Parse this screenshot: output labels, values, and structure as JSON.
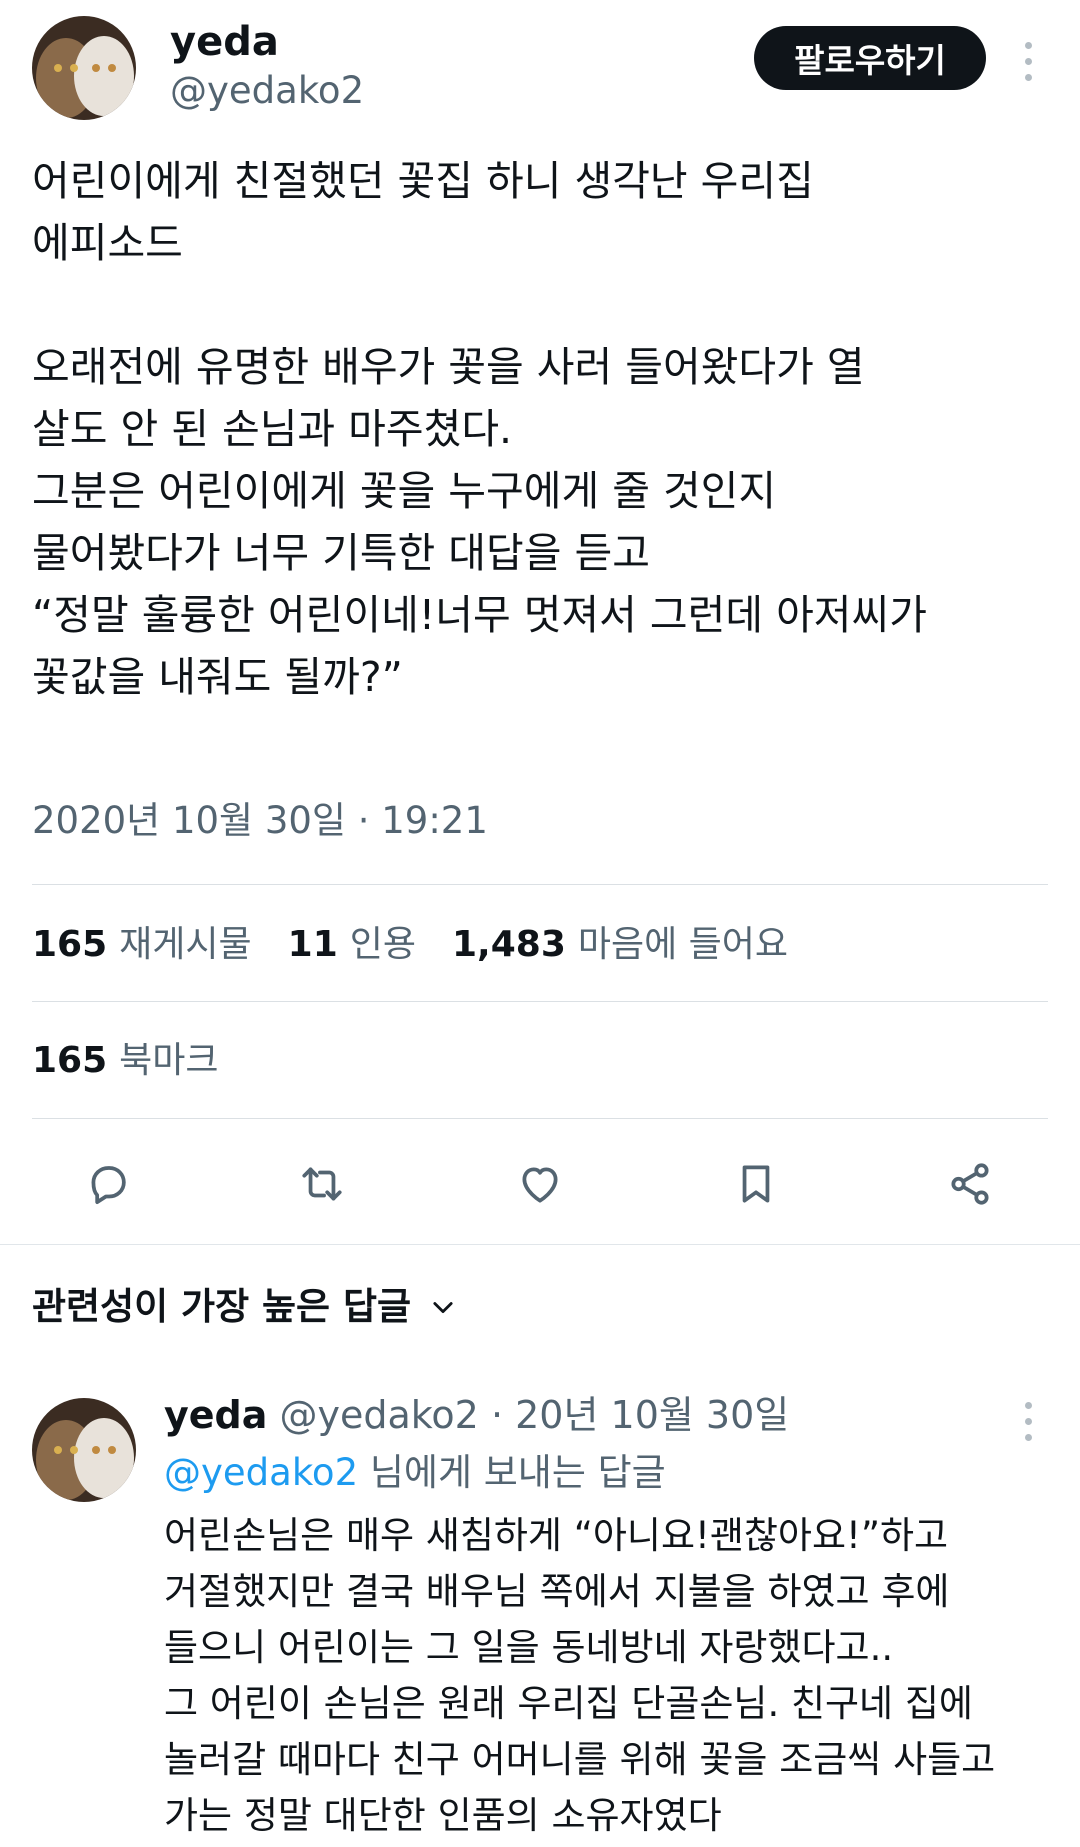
{
  "tweet": {
    "author": {
      "name": "yeda",
      "handle": "@yedako2"
    },
    "follow_label": "팔로우하기",
    "body_lines": [
      "어린이에게 친절했던 꽃집 하니 생각난 우리집",
      "에피소드",
      "",
      "오래전에 유명한 배우가 꽃을 사러 들어왔다가 열",
      "살도 안 된 손님과 마주쳤다.",
      "그분은 어린이에게 꽃을 누구에게 줄 것인지",
      "물어봤다가 너무 기특한 대답을 듣고",
      "“정말 훌륭한 어린이네!너무 멋져서 그런데 아저씨가",
      "꽃값을 내줘도 될까?”"
    ],
    "timestamp": "2020년 10월 30일 · 19:21"
  },
  "stats": {
    "retweets": {
      "count": "165",
      "label": "재게시물"
    },
    "quotes": {
      "count": "11",
      "label": "인용"
    },
    "likes": {
      "count": "1,483",
      "label": "마음에 들어요"
    },
    "bookmarks": {
      "count": "165",
      "label": "북마크"
    }
  },
  "actions": [
    "reply-icon",
    "retweet-icon",
    "like-icon",
    "bookmark-icon",
    "share-icon"
  ],
  "replies_sort": {
    "label": "관련성이 가장 높은 답글"
  },
  "reply": {
    "name": "yeda",
    "handle": "@yedako2",
    "date": "20년 10월 30일",
    "separator": "·",
    "reply_to_mention": "@yedako2",
    "reply_to_suffix": "님에게 보내는 답글",
    "body_lines": [
      "어린손님은 매우 새침하게 “아니요!괜찮아요!”하고",
      "거절했지만 결국 배우님 쪽에서 지불을 하였고 후에",
      "들으니 어린이는 그 일을 동네방네 자랑했다고..",
      "그 어린이 손님은 원래 우리집 단골손님. 친구네 집에",
      "놀러갈 때마다 친구 어머니를 위해 꽃을 조금씩 사들고",
      "가는 정말 대단한 인품의 소유자였다"
    ]
  },
  "colors": {
    "text": "#0f1419",
    "muted": "#536471",
    "link": "#1d9bf0",
    "divider": "#dbe0e4",
    "button": "#0f1419"
  }
}
